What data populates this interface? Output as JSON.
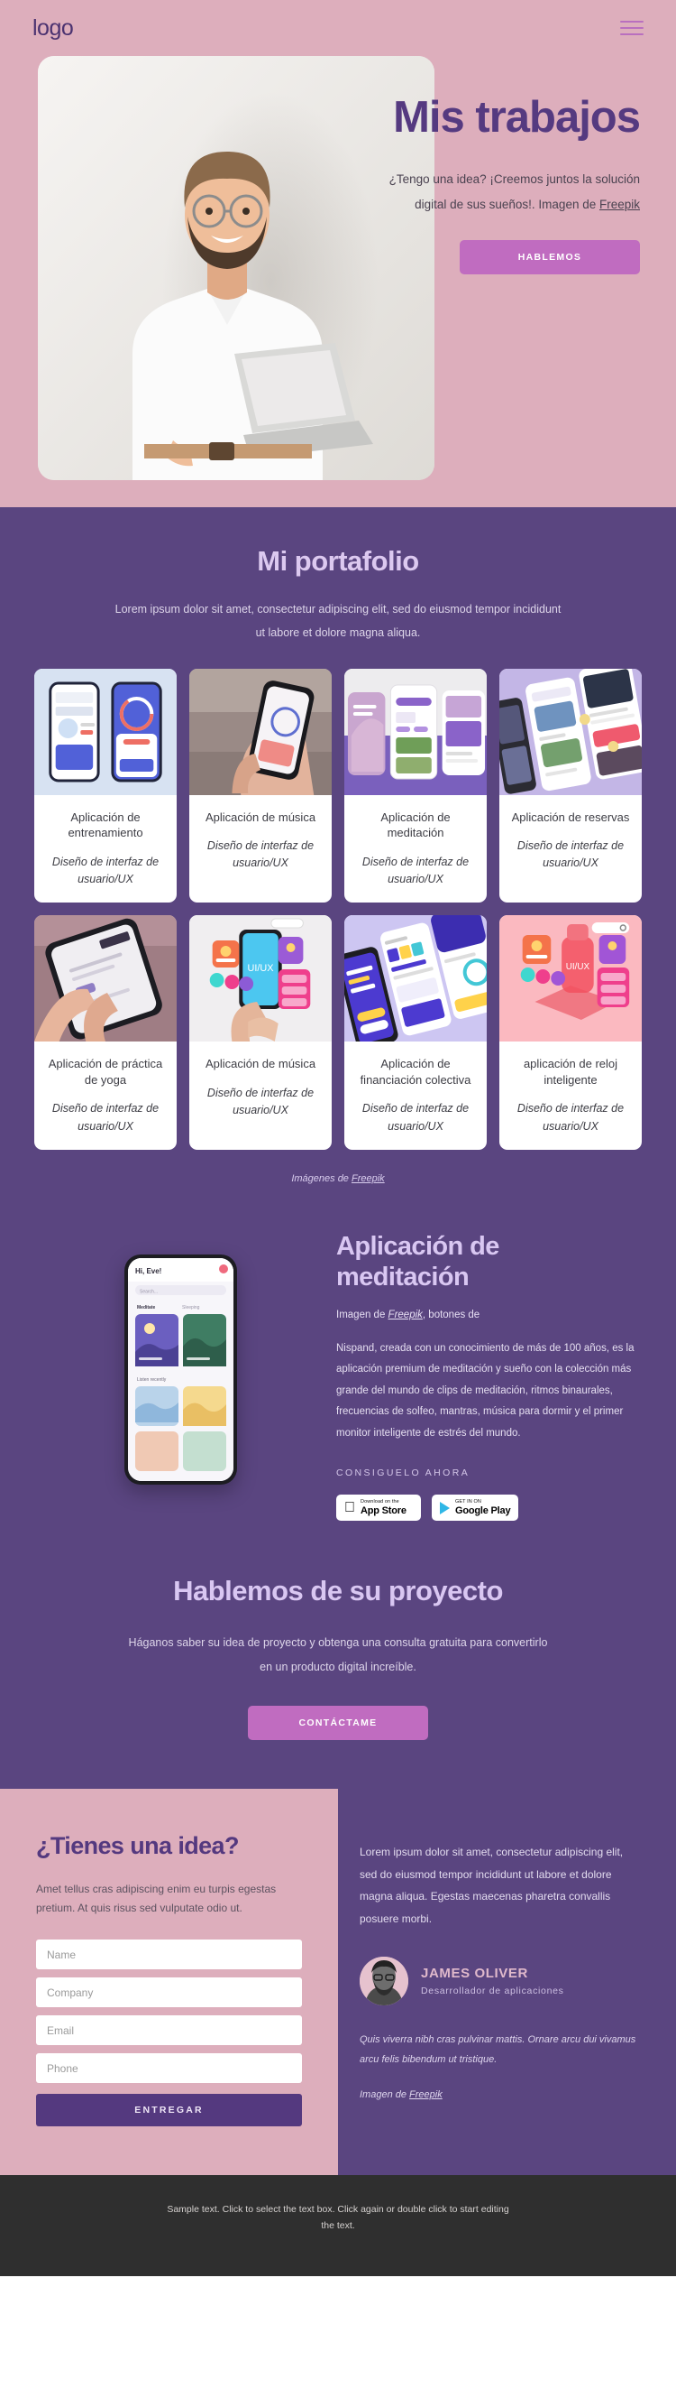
{
  "header": {
    "logo": "logo",
    "menu_icon": "hamburger-menu-icon"
  },
  "hero": {
    "title": "Mis trabajos",
    "subtitle_line1": "¿Tengo una idea? ¡Creemos juntos la solución",
    "subtitle_line2_pre": "digital de sus sueños!. Imagen de ",
    "subtitle_link": "Freepik",
    "button": "HABLEMOS",
    "photo_alt": "man-with-laptop-photo"
  },
  "portfolio": {
    "title": "Mi portafolio",
    "description": "Lorem ipsum dolor sit amet, consectetur adipiscing elit, sed do eiusmod tempor incididunt ut labore et dolore magna aliqua.",
    "role_label": "Diseño de interfaz de usuario/UX",
    "items": [
      {
        "name": "Aplicación de entrenamiento",
        "role": "Diseño de interfaz de usuario/UX",
        "thumb": "fitness-app-screens"
      },
      {
        "name": "Aplicación de música",
        "role": "Diseño de interfaz de usuario/UX",
        "thumb": "hand-holding-phone-music"
      },
      {
        "name": "Aplicación de meditación",
        "role": "Diseño de interfaz de usuario/UX",
        "thumb": "meditation-app-screens"
      },
      {
        "name": "Aplicación de reservas",
        "role": "Diseño de interfaz de usuario/UX",
        "thumb": "booking-app-screens"
      },
      {
        "name": "Aplicación de práctica de yoga",
        "role": "Diseño de interfaz de usuario/UX",
        "thumb": "hands-holding-phone-yoga"
      },
      {
        "name": "Aplicación de música",
        "role": "Diseño de interfaz de usuario/UX",
        "thumb": "hand-phone-uiux-colorful"
      },
      {
        "name": "Aplicación de financiación colectiva",
        "role": "Diseño de interfaz de usuario/UX",
        "thumb": "crowdfunding-app-screens"
      },
      {
        "name": "aplicación de reloj inteligente",
        "role": "Diseño de interfaz de usuario/UX",
        "thumb": "smartwatch-uiux-pink"
      }
    ],
    "credit_pre": "Imágenes de ",
    "credit_link": "Freepik"
  },
  "meditation": {
    "title": "Aplicación de meditación",
    "credit_pre": "Imagen de ",
    "credit_link": "Freepik",
    "credit_post": ", botones de",
    "body": "Nispand, creada con un conocimiento de más de 100 años, es la aplicación premium de meditación y sueño con la colección más grande del mundo de clips de meditación, ritmos binaurales, frecuencias de solfeo, mantras, música para dormir y el primer monitor inteligente de estrés del mundo.",
    "cta_label": "CONSIGUELO AHORA",
    "app_store": {
      "small": "Download on the",
      "big": "App Store"
    },
    "google_play": {
      "small": "GET IN ON",
      "big": "Google Play"
    },
    "phone_alt": "meditation-app-phone-mockup",
    "phone_greeting": "Hi, Eve!"
  },
  "talk": {
    "title": "Hablemos de su proyecto",
    "description": "Háganos saber su idea de proyecto y obtenga una consulta gratuita para convertirlo en un producto digital increíble.",
    "button": "CONTÁCTAME"
  },
  "contact": {
    "title": "¿Tienes una idea?",
    "description": "Amet tellus cras adipiscing enim eu turpis egestas pretium. At quis risus sed vulputate odio ut.",
    "fields": [
      {
        "name": "name",
        "placeholder": "Name",
        "value": ""
      },
      {
        "name": "company",
        "placeholder": "Company",
        "value": ""
      },
      {
        "name": "email",
        "placeholder": "Email",
        "value": ""
      },
      {
        "name": "phone",
        "placeholder": "Phone",
        "value": ""
      }
    ],
    "submit": "ENTREGAR"
  },
  "testimonial": {
    "quote": "Lorem ipsum dolor sit amet, consectetur adipiscing elit, sed do eiusmod tempor incididunt ut labore et dolore magna aliqua. Egestas maecenas pharetra convallis posuere morbi.",
    "author_name": "JAMES OLIVER",
    "author_role": "Desarrollador de aplicaciones",
    "avatar_alt": "james-oliver-portrait",
    "italic_note": "Quis viverra nibh cras pulvinar mattis. Ornare arcu dui vivamus arcu felis bibendum ut tristique.",
    "credit_pre": "Imagen de ",
    "credit_link": "Freepik"
  },
  "footer": {
    "text": "Sample text. Click to select the text box. Click again or double click to start editing the text."
  },
  "colors": {
    "pink": "#ddaebc",
    "purple": "#5a4580",
    "deep_purple": "#54397f",
    "accent_magenta": "#c06cc0",
    "light_lavender": "#d9c7f2",
    "footer_bg": "#2f2f2f"
  }
}
